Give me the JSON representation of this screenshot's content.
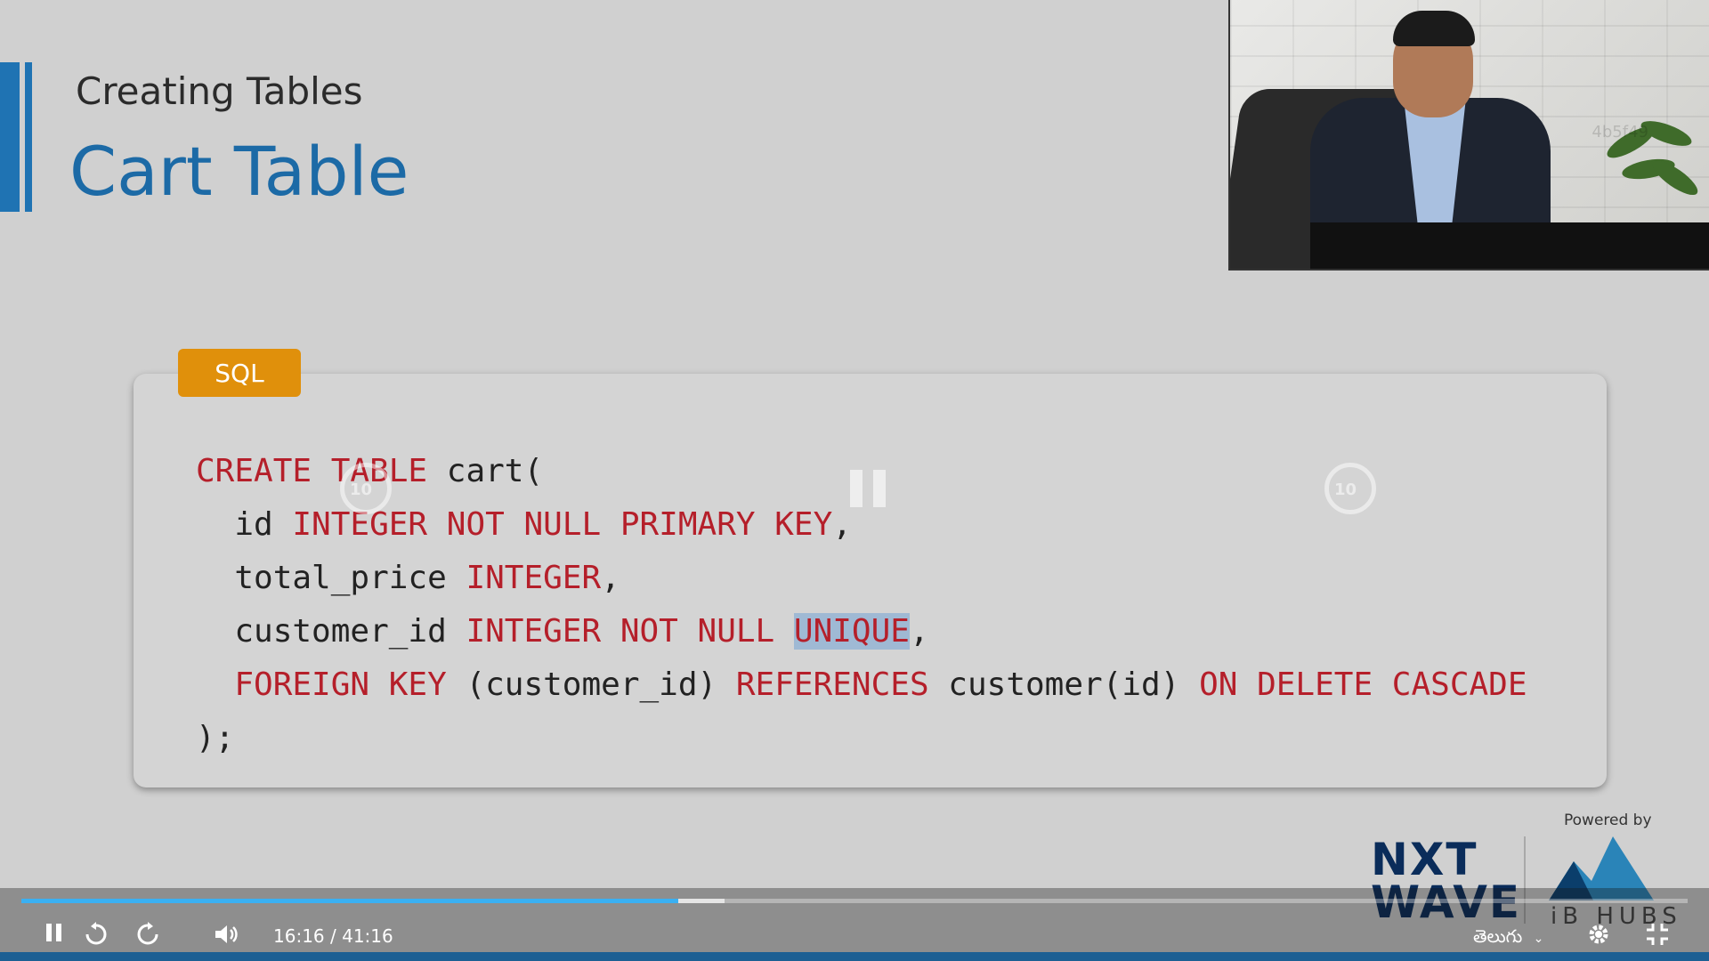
{
  "slide": {
    "subtitle": "Creating Tables",
    "title": "Cart Table",
    "code_language": "SQL",
    "code_lines": [
      [
        {
          "t": "CREATE TABLE",
          "k": true
        },
        {
          "t": " cart(",
          "k": false
        }
      ],
      [
        {
          "t": "  id ",
          "k": false
        },
        {
          "t": "INTEGER NOT NULL PRIMARY KEY",
          "k": true
        },
        {
          "t": ",",
          "k": false
        }
      ],
      [
        {
          "t": "  total_price ",
          "k": false
        },
        {
          "t": "INTEGER",
          "k": true
        },
        {
          "t": ",",
          "k": false
        }
      ],
      [
        {
          "t": "  customer_id ",
          "k": false
        },
        {
          "t": "INTEGER NOT NULL",
          "k": true
        },
        {
          "t": " ",
          "k": false
        },
        {
          "t": "UNIQUE",
          "k": true,
          "h": true
        },
        {
          "t": ",",
          "k": false
        }
      ],
      [
        {
          "t": "  FOREIGN KEY",
          "k": true
        },
        {
          "t": " (customer_id) ",
          "k": false
        },
        {
          "t": "REFERENCES",
          "k": true
        },
        {
          "t": " customer(id) ",
          "k": false
        },
        {
          "t": "ON DELETE CASCADE",
          "k": true
        }
      ],
      [
        {
          "t": ");",
          "k": false
        }
      ]
    ],
    "keyword_color": "#b51f2a",
    "title_color": "#1c6aa6",
    "badge_color": "#e0900b"
  },
  "presenter_watermark": "4b5f49",
  "overlay": {
    "rewind_seconds": "10",
    "forward_seconds": "10",
    "center_icon": "pause-icon"
  },
  "branding": {
    "powered_by": "Powered by",
    "logo_left_line1": "NXT",
    "logo_left_line2": "WAVE",
    "logo_right": "iB HUBS"
  },
  "player": {
    "current_time": "16:16",
    "separator": "/",
    "duration": "41:16",
    "progress_fraction": 0.394,
    "language": "తెలుగు",
    "progress_color": "#3ab0f2",
    "icons": [
      "pause-icon",
      "rewind-10-icon",
      "forward-10-icon",
      "volume-icon",
      "chevron-down-icon",
      "gear-icon",
      "exit-fullscreen-icon"
    ]
  }
}
